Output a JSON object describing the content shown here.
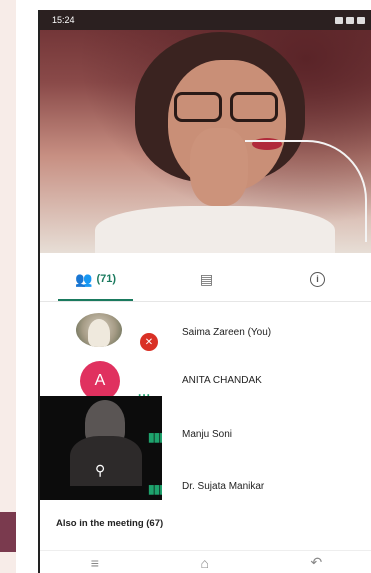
{
  "status_bar": {
    "time": "15:24"
  },
  "tabs": [
    {
      "label": "(71)",
      "icon": "people-icon",
      "active": true
    },
    {
      "label": "",
      "icon": "chat-icon",
      "active": false
    },
    {
      "label": "",
      "icon": "info-icon",
      "active": false
    }
  ],
  "participants": [
    {
      "name": "Saima Zareen (You)",
      "avatar": "photo",
      "muted": true
    },
    {
      "name": "ANITA CHANDAK",
      "avatar": "A",
      "speaking_indicator": "..."
    },
    {
      "name": "Manju Soni",
      "avatar": "video"
    },
    {
      "name": "Dr. Sujata Manikar",
      "avatar": "video"
    }
  ],
  "also_in_meeting": "Also in the meeting (67)",
  "colors": {
    "accent": "#1a7a5e",
    "avatar_a": "#e0315f",
    "muted": "#d93025",
    "speaking": "#1ea36d"
  }
}
